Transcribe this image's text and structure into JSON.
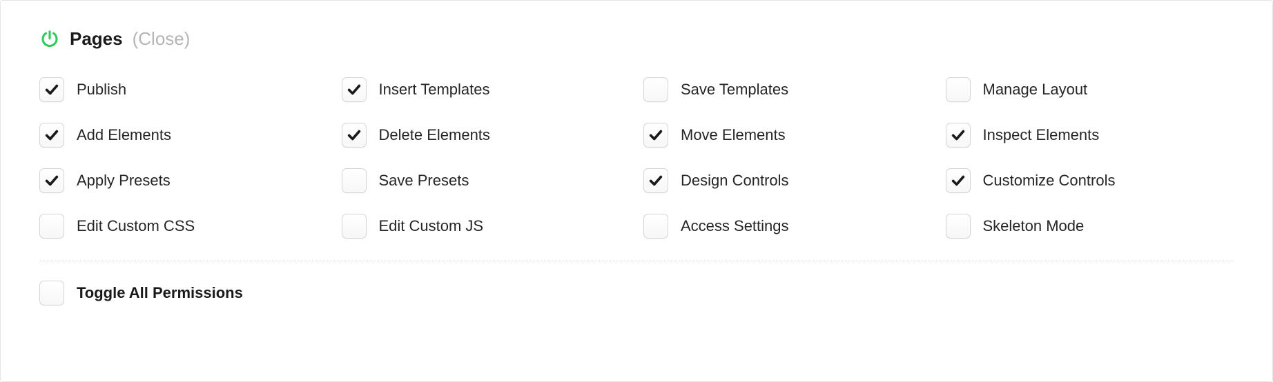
{
  "header": {
    "title": "Pages",
    "close": "(Close)"
  },
  "permissions": [
    {
      "label": "Publish",
      "checked": true
    },
    {
      "label": "Insert Templates",
      "checked": true
    },
    {
      "label": "Save Templates",
      "checked": false
    },
    {
      "label": "Manage Layout",
      "checked": false
    },
    {
      "label": "Add Elements",
      "checked": true
    },
    {
      "label": "Delete Elements",
      "checked": true
    },
    {
      "label": "Move Elements",
      "checked": true
    },
    {
      "label": "Inspect Elements",
      "checked": true
    },
    {
      "label": "Apply Presets",
      "checked": true
    },
    {
      "label": "Save Presets",
      "checked": false
    },
    {
      "label": "Design Controls",
      "checked": true
    },
    {
      "label": "Customize Controls",
      "checked": true
    },
    {
      "label": "Edit Custom CSS",
      "checked": false
    },
    {
      "label": "Edit Custom JS",
      "checked": false
    },
    {
      "label": "Access Settings",
      "checked": false
    },
    {
      "label": "Skeleton Mode",
      "checked": false
    }
  ],
  "toggle_all": {
    "label": "Toggle All Permissions",
    "checked": false
  }
}
